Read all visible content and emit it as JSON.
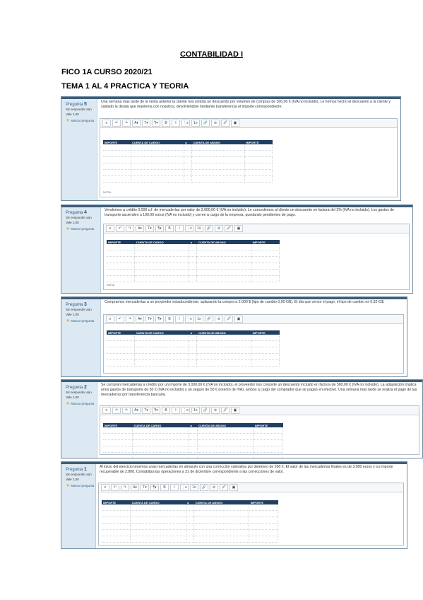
{
  "doc": {
    "title": "CONTABILIDAD I",
    "course": "FICO 1A CURSO 2020/21",
    "topic": "TEMA 1 AL 4 PRACTICA Y TEORIA"
  },
  "toolbar": [
    "≡",
    "↶",
    "↷",
    "A▾",
    "T▾",
    "¶▾",
    "B",
    "I",
    "⋮≡",
    "1≡",
    "🔗",
    "⊘",
    "🖉",
    "▣"
  ],
  "table_headers": [
    "IMPORTE",
    "CUENTA DE CARGO",
    "a",
    "CUENTA DE ABONO",
    "IMPORTE"
  ],
  "questions": [
    {
      "label": "Pregunta",
      "number": "5",
      "status": "Sin responder aún",
      "score": "Vale 1,00",
      "flag": "Marcar pregunta",
      "statement": "Una semana más tarde de la venta anterior la cliente nos solicita un descuento por volumen de compras de 300,00 € (IVA no incluido). Le hemos hecho el descuento a la cliente y saldado la deuda que mantenía con nosotros, devolviéndole mediante transferencia el importe correspondiente.",
      "extra": "NOTA:"
    },
    {
      "label": "Pregunta",
      "number": "4",
      "status": "Sin responder aún",
      "score": "Vale 1,00",
      "flag": "Marcar pregunta",
      "statement": "Vendemos a crédito 3.000 u.f. de mercaderías por valor de 3.000,00 € (IVA no incluido). Le concedemos al cliente un descuento en factura del 3% (IVA no incluido). Los gastos de transporte ascienden a 100,00 euros (IVA no incluido) y corren a cargo de la empresa, quedando pendientes de pago.",
      "extra": "NOTA:"
    },
    {
      "label": "Pregunta",
      "number": "3",
      "status": "Sin responder aún",
      "score": "Vale 1,00",
      "flag": "Marcar pregunta",
      "statement": "Compramos mercaderías a un proveedor estadounidense, aplazando la compra a 2.000 $ (tipo de cambio 0,90 €/$). El día que vence el pago, el tipo de cambio es 0,92 €/$.",
      "extra": ""
    },
    {
      "label": "Pregunta",
      "number": "2",
      "status": "Sin responder aún",
      "score": "Vale 1,00",
      "flag": "Marcar pregunta",
      "statement": "Se compran mercaderías a crédito por un importe de 3.000,00 € (IVA no incluido), el proveedor nos concede un descuento incluido en factura de 500,00 € (IVA no incluido). La adquisición implica unos gastos de transporte de 50 € (IVA no incluido) y un seguro de 50 € (exento de IVA), ambos a cargo del comprador que se pagan en efectivo. Una semana más tarde se realiza el pago de las mercaderías por transferencia bancaria.",
      "extra": ""
    },
    {
      "label": "Pregunta",
      "number": "1",
      "status": "Sin responder aún",
      "score": "Vale 1,00",
      "flag": "Marcar pregunta",
      "statement": "Al inicio del ejercicio tenemos unas mercaderías en almacén con una corrección valorativa por deterioro de 200 €. El valor de las mercaderías finales es de 3.000 euros y su importe recuperable de 2.800. Contabiliza las operaciones a 31 de diciembre correspondiente a las correcciones de valor.",
      "extra": ""
    }
  ]
}
